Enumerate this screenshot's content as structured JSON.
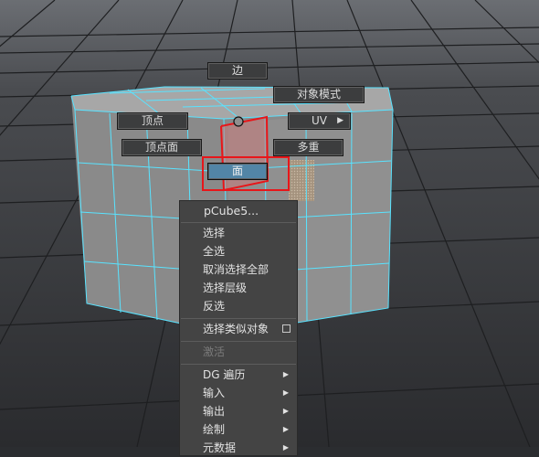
{
  "hotbox": {
    "edge": "边",
    "object_mode": "对象模式",
    "vertex": "顶点",
    "uv": "UV",
    "vertex_face": "顶点面",
    "multi": "多重",
    "face": "面"
  },
  "context_menu": {
    "title": "pCube5...",
    "items": [
      {
        "label": "选择",
        "enabled": true
      },
      {
        "label": "全选",
        "enabled": true
      },
      {
        "label": "取消选择全部",
        "enabled": true
      },
      {
        "label": "选择层级",
        "enabled": true
      },
      {
        "label": "反选",
        "enabled": true
      },
      {
        "label": "选择类似对象",
        "enabled": true,
        "checkbox": true
      },
      {
        "label": "激活",
        "enabled": false
      },
      {
        "label": "DG 遍历",
        "enabled": true,
        "submenu": true
      },
      {
        "label": "输入",
        "enabled": true,
        "submenu": true
      },
      {
        "label": "输出",
        "enabled": true,
        "submenu": true
      },
      {
        "label": "绘制",
        "enabled": true,
        "submenu": true
      },
      {
        "label": "元数据",
        "enabled": true,
        "submenu": true
      }
    ]
  },
  "icons": {
    "submenu": "triangle-right-icon",
    "checkbox": "checkbox-icon"
  },
  "colors": {
    "viewport_bg": "#2b2d30",
    "grid": "#1c1c1e",
    "cube_face": "#8c8c8c",
    "wire": "#59e3ff",
    "highlight": "#e8161a",
    "selected_face": "#5285a6"
  }
}
